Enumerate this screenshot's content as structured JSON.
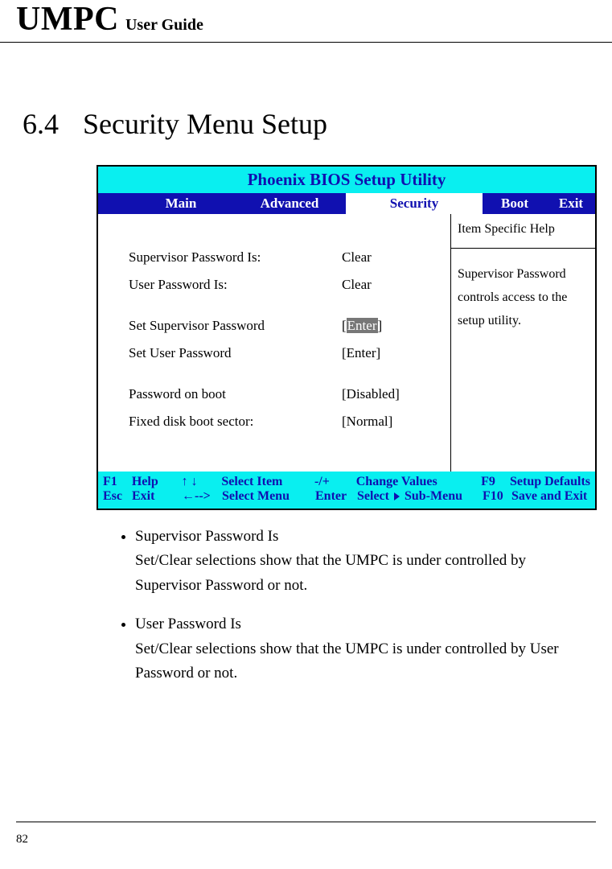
{
  "header": {
    "umpc": "UMPC",
    "guide": "User Guide"
  },
  "section": {
    "number": "6.4",
    "title": "Security Menu Setup"
  },
  "bios": {
    "title": "Phoenix BIOS Setup Utility",
    "tabs": {
      "main": "Main",
      "advanced": "Advanced",
      "security": "Security",
      "boot": "Boot",
      "exit": "Exit"
    },
    "fields": {
      "supervisor_pw_is_label": "Supervisor Password Is:",
      "supervisor_pw_is_value": "Clear",
      "user_pw_is_label": "User Password Is:",
      "user_pw_is_value": "Clear",
      "set_supervisor_label": "Set Supervisor Password",
      "set_supervisor_value_open": "[",
      "set_supervisor_value_mid": "Enter",
      "set_supervisor_value_close": "]",
      "set_user_label": "Set User Password",
      "set_user_value": "[Enter]",
      "pw_on_boot_label": "Password on boot",
      "pw_on_boot_value": "[Disabled]",
      "fixed_disk_label": "Fixed disk boot sector:",
      "fixed_disk_value": "[Normal]"
    },
    "help": {
      "title": "Item Specific Help",
      "body": "Supervisor Password controls access to the setup utility."
    },
    "footer": {
      "row1": {
        "f1": "F1",
        "help": "Help",
        "arrows_ud": "↑ ↓",
        "select_item": "Select Item",
        "plusminus": "-/+",
        "change_values": "Change Values",
        "f9": "F9",
        "setup_defaults": "Setup Defaults"
      },
      "row2": {
        "esc": "Esc",
        "exit": "Exit",
        "arrow_l": "←-->",
        "select_menu": "Select Menu",
        "enter": "Enter",
        "select_submenu_a": "Select",
        "select_submenu_b": "Sub-Menu",
        "f10": "F10",
        "save_exit": "Save and Exit"
      }
    }
  },
  "explain": {
    "items": [
      {
        "title": "Supervisor Password Is",
        "body": "Set/Clear selections show that the UMPC is under controlled by Supervisor Password or not."
      },
      {
        "title": "User Password Is",
        "body": "Set/Clear selections show that the UMPC is under controlled by User Password or not."
      }
    ]
  },
  "page_number": "82"
}
